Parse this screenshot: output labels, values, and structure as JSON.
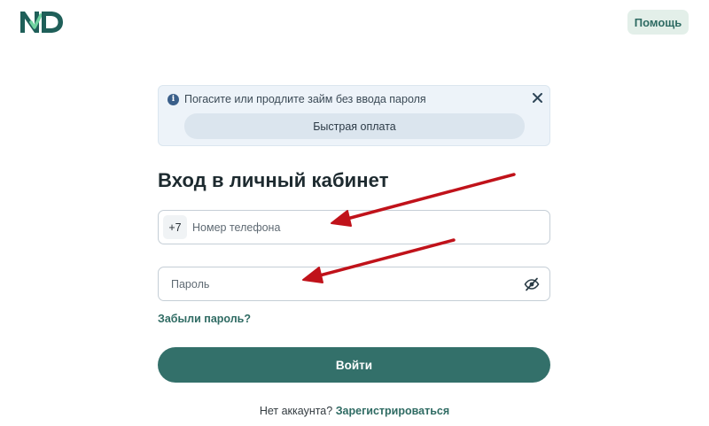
{
  "header": {
    "logo_text": "ND",
    "help_label": "Помощь"
  },
  "banner": {
    "icon": "info-icon",
    "text": "Погасите или продлите займ без ввода пароля",
    "quick_pay_label": "Быстрая оплата",
    "close_icon": "close-icon"
  },
  "login": {
    "title": "Вход в личный кабинет",
    "phone_prefix": "+7",
    "phone_placeholder": "Номер телефона",
    "password_placeholder": "Пароль",
    "password_toggle_icon": "eye-slash-icon",
    "forgot_label": "Забыли пароль?",
    "submit_label": "Войти",
    "no_account_text": "Нет аккаунта?",
    "register_label": "Зарегистрироваться"
  },
  "colors": {
    "brand": "#33706a",
    "brand_light": "#e3efe9",
    "banner_bg": "#edf3f9",
    "annotation_arrow": "#c0121a"
  }
}
